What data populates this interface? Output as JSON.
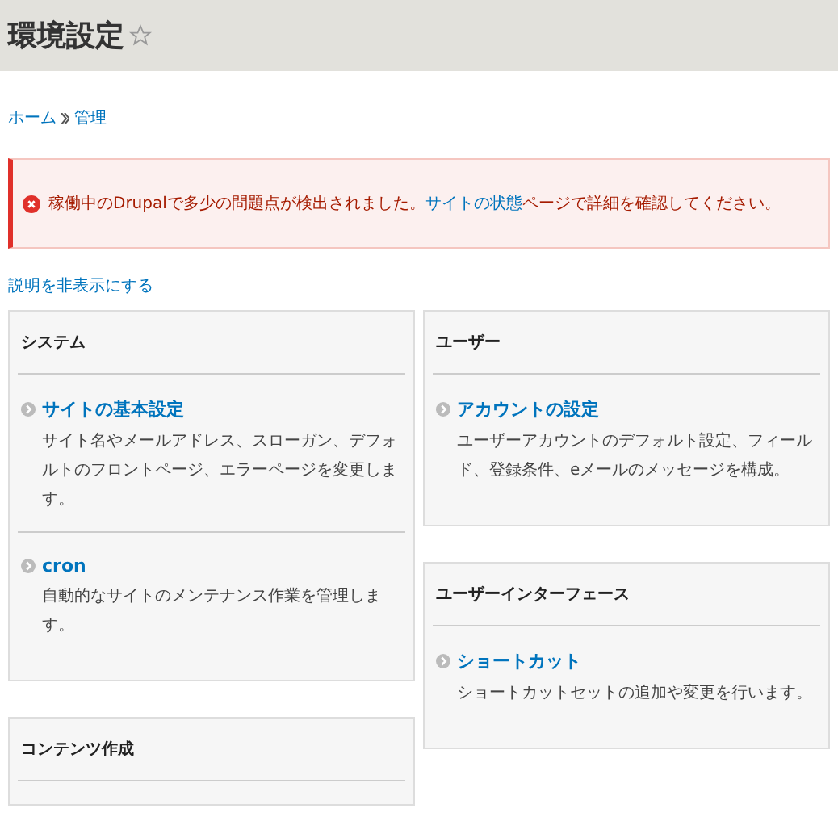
{
  "page_title": "環境設定",
  "favorite": false,
  "breadcrumb": [
    "ホーム",
    "管理"
  ],
  "error": {
    "before": "稼働中のDrupalで多少の問題点が検出されました。",
    "link": "サイトの状態",
    "after": "ページで詳細を確認してください。"
  },
  "toggle_descriptions": "説明を非表示にする",
  "columns": [
    [
      {
        "title": "システム",
        "items": [
          {
            "link": "サイトの基本設定",
            "description": "サイト名やメールアドレス、スローガン、デフォルトのフロントページ、エラーページを変更します。"
          },
          {
            "link": "cron",
            "description": "自動的なサイトのメンテナンス作業を管理します。"
          }
        ]
      },
      {
        "title": "コンテンツ作成"
      }
    ],
    [
      {
        "title": "ユーザー",
        "items": [
          {
            "link": "アカウントの設定",
            "description": "ユーザーアカウントのデフォルト設定、フィールド、登録条件、eメールのメッセージを構成。"
          }
        ]
      },
      {
        "title": "ユーザーインターフェース",
        "items": [
          {
            "link": "ショートカット",
            "description": "ショートカットセットの追加や変更を行います。"
          }
        ]
      }
    ]
  ]
}
